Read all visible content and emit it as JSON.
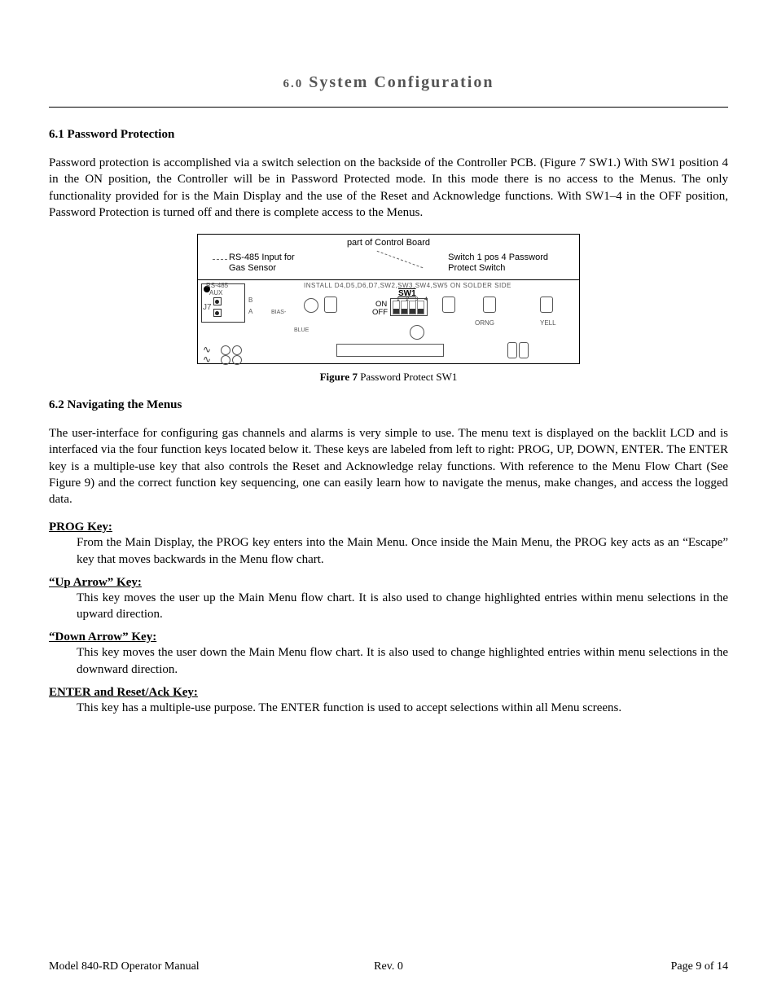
{
  "header": {
    "section_number": "6.0",
    "section_title": "System Configuration"
  },
  "sections": {
    "s61": {
      "heading": "6.1 Password Protection",
      "paragraph": "Password protection is accomplished via a switch selection on the backside of the Controller PCB.  (Figure 7 SW1.)  With SW1 position 4 in the ON position, the Controller will be in Password Protected mode.  In this mode there is no access to the Menus.  The only functionality provided for is the Main Display and the use of the Reset and Acknowledge functions.  With SW1–4 in the OFF position, Password Protection is turned off and there is complete access to the Menus."
    },
    "figure7": {
      "top_label": "part of Control Board",
      "left_label_line1": "RS-485 Input for",
      "left_label_line2": "Gas Sensor",
      "right_label_line1": "Switch 1 pos 4 Password",
      "right_label_line2": "Protect Switch",
      "pcb_text_install": "INSTALL  D4,D5,D6,D7,SW2,SW3,SW4,SW5  ON  SOLDER  SIDE",
      "sw1_label": "SW1",
      "sw1_nums": "1 2 3 4",
      "on_label": "ON",
      "off_label": "OFF",
      "rs485_label": "RS-485",
      "aux_label": "AUX",
      "j7_label": "J7",
      "b_label": "B",
      "a_label": "A",
      "bias_label": "BIAS-",
      "blue_label": "BLUE",
      "orng_label": "ORNG",
      "yell_label": "YELL",
      "caption_bold": "Figure 7",
      "caption_rest": " Password Protect SW1"
    },
    "s62": {
      "heading": "6.2 Navigating the Menus",
      "paragraph": "The user-interface for configuring gas channels and alarms is very simple to use.  The menu text is displayed on the backlit LCD and is interfaced via the four function keys located below it.  These keys are labeled from left to right: PROG, UP, DOWN, ENTER.  The ENTER key is a multiple-use key that also controls the Reset and Acknowledge relay functions.   With reference to the Menu Flow Chart (See Figure 9) and the correct function key sequencing, one can easily learn how to navigate the menus, make changes, and access the logged data."
    },
    "keys": {
      "prog": {
        "label": "PROG Key:",
        "desc": "From the Main Display, the PROG key enters into the Main Menu.  Once inside the Main Menu, the PROG key acts as an “Escape” key that moves backwards in the Menu flow chart."
      },
      "up": {
        "label": "“Up Arrow” Key:",
        "desc": "This key moves the user up the Main Menu flow chart.  It is also used to change highlighted entries within menu selections in the upward direction."
      },
      "down": {
        "label": "“Down Arrow” Key:",
        "desc": "This key moves the user down the Main Menu flow chart.  It is also used to change highlighted entries within menu selections in the downward direction."
      },
      "enter": {
        "label": "ENTER and Reset/Ack Key:",
        "desc": "This key has a multiple-use purpose.  The ENTER function is used to accept selections within all Menu screens."
      }
    }
  },
  "footer": {
    "left": "Model 840-RD Operator Manual",
    "center": "Rev. 0",
    "right": "Page 9 of 14"
  }
}
